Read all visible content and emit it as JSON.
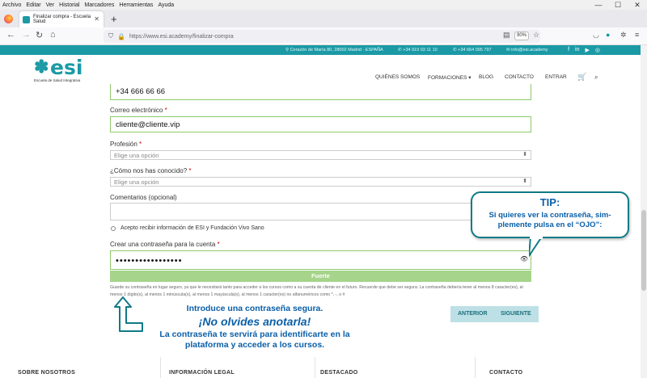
{
  "browser": {
    "menu": [
      "Archivo",
      "Editar",
      "Ver",
      "Historial",
      "Marcadores",
      "Herramientas",
      "Ayuda"
    ],
    "tab_title": "Finalizar compra - Escuela Salud",
    "url": "https://www.esi.academy/finalizar-compra",
    "zoom": "90%"
  },
  "topbar": {
    "address": "Corazón de María 80, 28002 Madrid - ESPAÑA",
    "phone1": "+34 919 03 11 10",
    "phone2": "+34 664 095 797",
    "email": "info@esi.academy",
    "social": [
      "f",
      "in",
      "▶",
      "◎"
    ]
  },
  "header": {
    "logo_text": "esi",
    "logo_sub": "Escuela de Salud Integrativa",
    "nav": [
      "QUIÉNES SOMOS",
      "FORMACIONES",
      "BLOG",
      "CONTACTO",
      "ENTRAR"
    ]
  },
  "form": {
    "phone_value": "+34 666 66 66",
    "email_label": "Correo electrónico",
    "email_value": "cliente@cliente.vip",
    "profession_label": "Profesión",
    "profession_placeholder": "Elige una opción",
    "source_label": "¿Cómo nos has conocido?",
    "source_placeholder": "Elige una opción",
    "comments_label": "Comentarios (opcional)",
    "consent_label": "Acepto recibir información de ESI y Fundación Vivo Sano",
    "password_label": "Crear una contraseña para la cuenta",
    "password_value": "•••••••••••••••••",
    "strength": "Fuerte",
    "hint": "Guarde su contraseña en lugar seguro, ya que le necesitará tanto para acceder a los cursos como a su cuenta de cliente en el futuro. Recuerde que debe ser segura: La contraseña debería tener al menos 8 caracter(es), al menos 1 dígito(s), al menos 1 minúscula(s), al menos 1 mayúscula(s), al menos 1 caracter(es) no alfanuméricos como *, -, o #",
    "required_mark": "*"
  },
  "tip": {
    "title": "TIP:",
    "body": "Si quieres ver la contraseña, sim-plemente pulsa en el “OJO”:"
  },
  "note": {
    "line1": "Introduce una contraseña segura.",
    "line2": "¡No olvides anotarla!",
    "line3": "La contraseña te servirá para identificarte en la plataforma y acceder a los cursos."
  },
  "buttons": {
    "back": "ANTERIOR",
    "next": "SIGUIENTE"
  },
  "footer": [
    "SOBRE NOSOTROS",
    "INFORMACIÓN LEGAL",
    "DESTACADO",
    "CONTACTO"
  ],
  "colors": {
    "brand": "#1b9aa6",
    "valid_border": "#8dc96a",
    "strength_bar": "#a5d48a",
    "annotation": "#0a5fa8"
  }
}
